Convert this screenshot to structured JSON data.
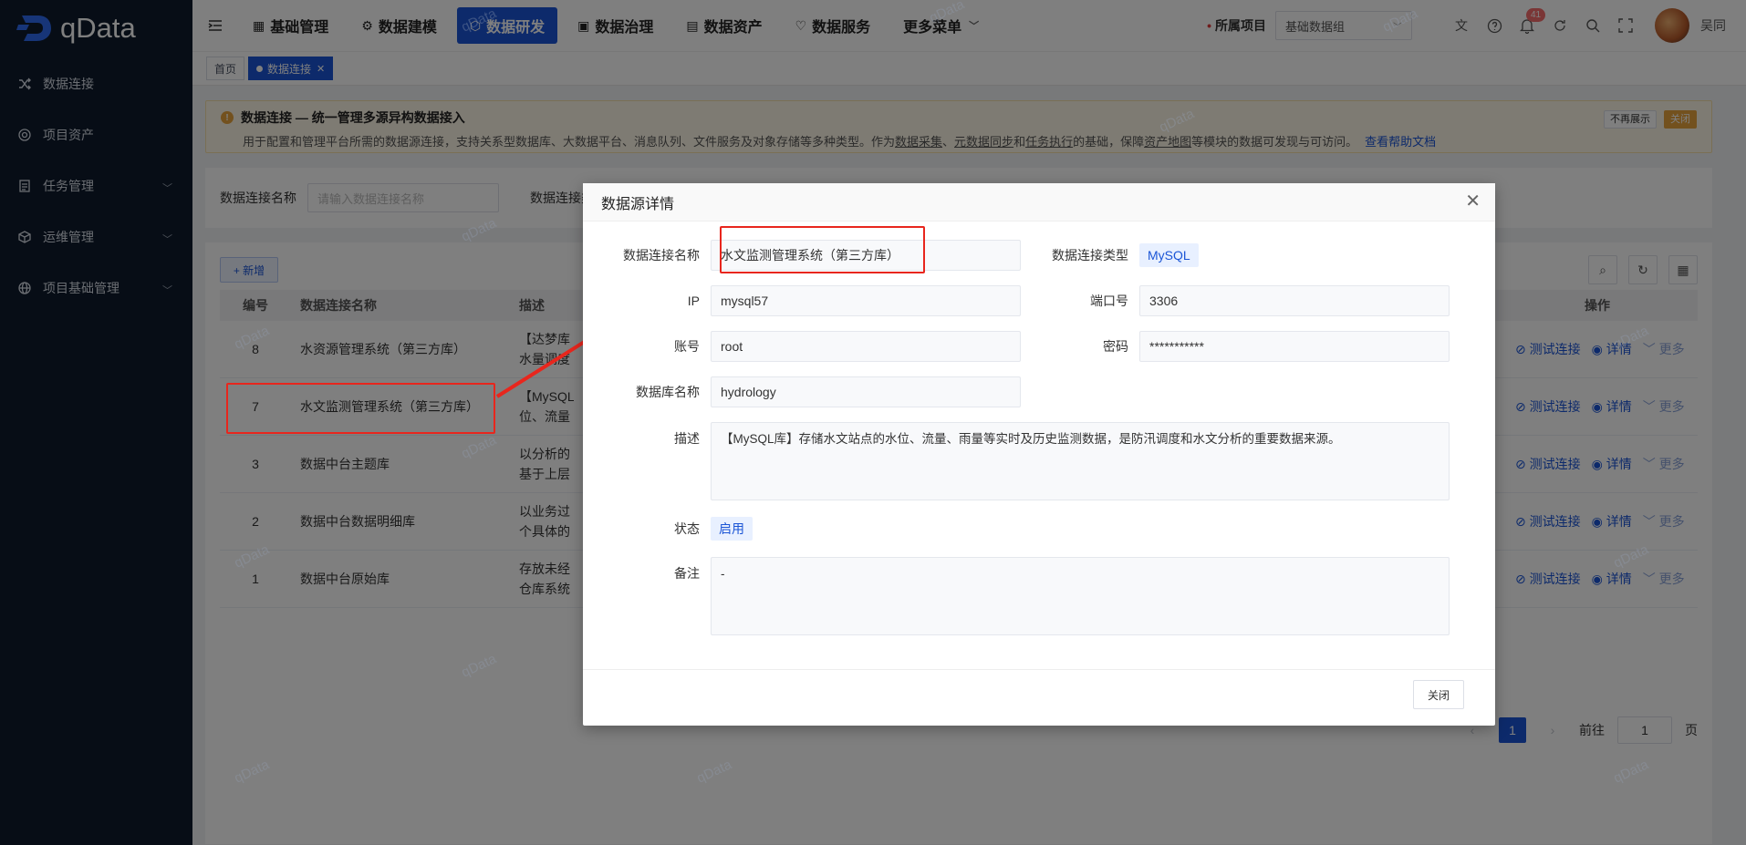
{
  "brand": {
    "name": "qData"
  },
  "sidebar": {
    "items": [
      {
        "label": "数据连接",
        "icon": "shuffle-icon",
        "has_arrow": false
      },
      {
        "label": "项目资产",
        "icon": "target-icon",
        "has_arrow": false
      },
      {
        "label": "任务管理",
        "icon": "document-icon",
        "has_arrow": true
      },
      {
        "label": "运维管理",
        "icon": "cube-icon",
        "has_arrow": true
      },
      {
        "label": "项目基础管理",
        "icon": "globe-icon",
        "has_arrow": true
      }
    ]
  },
  "topnav": {
    "tabs": [
      {
        "label": "基础管理",
        "icon": "grid-icon"
      },
      {
        "label": "数据建模",
        "icon": "gear-icon"
      },
      {
        "label": "数据研发",
        "icon": "hexagon-icon",
        "active": true
      },
      {
        "label": "数据治理",
        "icon": "image-icon"
      },
      {
        "label": "数据资产",
        "icon": "report-icon"
      },
      {
        "label": "数据服务",
        "icon": "heart-icon"
      },
      {
        "label": "更多菜单",
        "icon": "chevron-down-icon"
      }
    ],
    "project_label": "所属项目",
    "project_value": "基础数据组",
    "notification_count": "41",
    "user_name": "吴同"
  },
  "tags": {
    "home": "首页",
    "current": "数据连接"
  },
  "notice": {
    "title": "数据连接 — 统一管理多源异构数据接入",
    "desc_prefix": "用于配置和管理平台所需的数据源连接，支持关系型数据库、大数据平台、消息队列、文件服务及对象存储等多种类型。作为",
    "link1": "数据采集",
    "sep1": "、",
    "link2": "元数据同步",
    "sep2": "和",
    "link3": "任务执行",
    "desc_mid": "的基础，保障",
    "link4": "资产地图",
    "desc_suffix": "等模块的数据可发现与可访问。",
    "help": "查看帮助文档",
    "btn_hide": "不再展示",
    "btn_close": "关闭"
  },
  "search": {
    "name_label": "数据连接名称",
    "name_placeholder": "请输入数据连接名称",
    "type_label": "数据连接类型"
  },
  "table": {
    "add_label": "+ 新增",
    "headers": {
      "id": "编号",
      "name": "数据连接名称",
      "desc": "描述",
      "op": "操作"
    },
    "rows": [
      {
        "id": "8",
        "name": "水资源管理系统（第三方库）",
        "desc1": "【达梦库",
        "desc2": "水量调度"
      },
      {
        "id": "7",
        "name": "水文监测管理系统（第三方库）",
        "desc1": "【MySQL",
        "desc2": "位、流量"
      },
      {
        "id": "3",
        "name": "数据中台主题库",
        "desc1": "以分析的",
        "desc2": "基于上层"
      },
      {
        "id": "2",
        "name": "数据中台数据明细库",
        "desc1": "以业务过",
        "desc2": "个具体的"
      },
      {
        "id": "1",
        "name": "数据中台原始库",
        "desc1": "存放未经",
        "desc2": "仓库系统"
      }
    ],
    "op_test": "测试连接",
    "op_detail": "详情",
    "op_more": "更多",
    "pager": {
      "current": "1",
      "goto_label": "前往",
      "goto_value": "1",
      "page_unit": "页"
    }
  },
  "dialog": {
    "title": "数据源详情",
    "fields": {
      "name_label": "数据连接名称",
      "name_value": "水文监测管理系统（第三方库）",
      "type_label": "数据连接类型",
      "type_value": "MySQL",
      "ip_label": "IP",
      "ip_value": "mysql57",
      "port_label": "端口号",
      "port_value": "3306",
      "account_label": "账号",
      "account_value": "root",
      "password_label": "密码",
      "password_value": "***********",
      "db_label": "数据库名称",
      "db_value": "hydrology",
      "desc_label": "描述",
      "desc_value": "【MySQL库】存储水文站点的水位、流量、雨量等实时及历史监测数据，是防汛调度和水文分析的重要数据来源。",
      "status_label": "状态",
      "status_value": "启用",
      "remark_label": "备注",
      "remark_value": "-"
    },
    "close_label": "关闭"
  },
  "watermark": "qData",
  "colors": {
    "primary": "#1b55d6",
    "sidebar": "#0f1b2d",
    "highlight": "#e8261d",
    "warning": "#e6a23c"
  }
}
